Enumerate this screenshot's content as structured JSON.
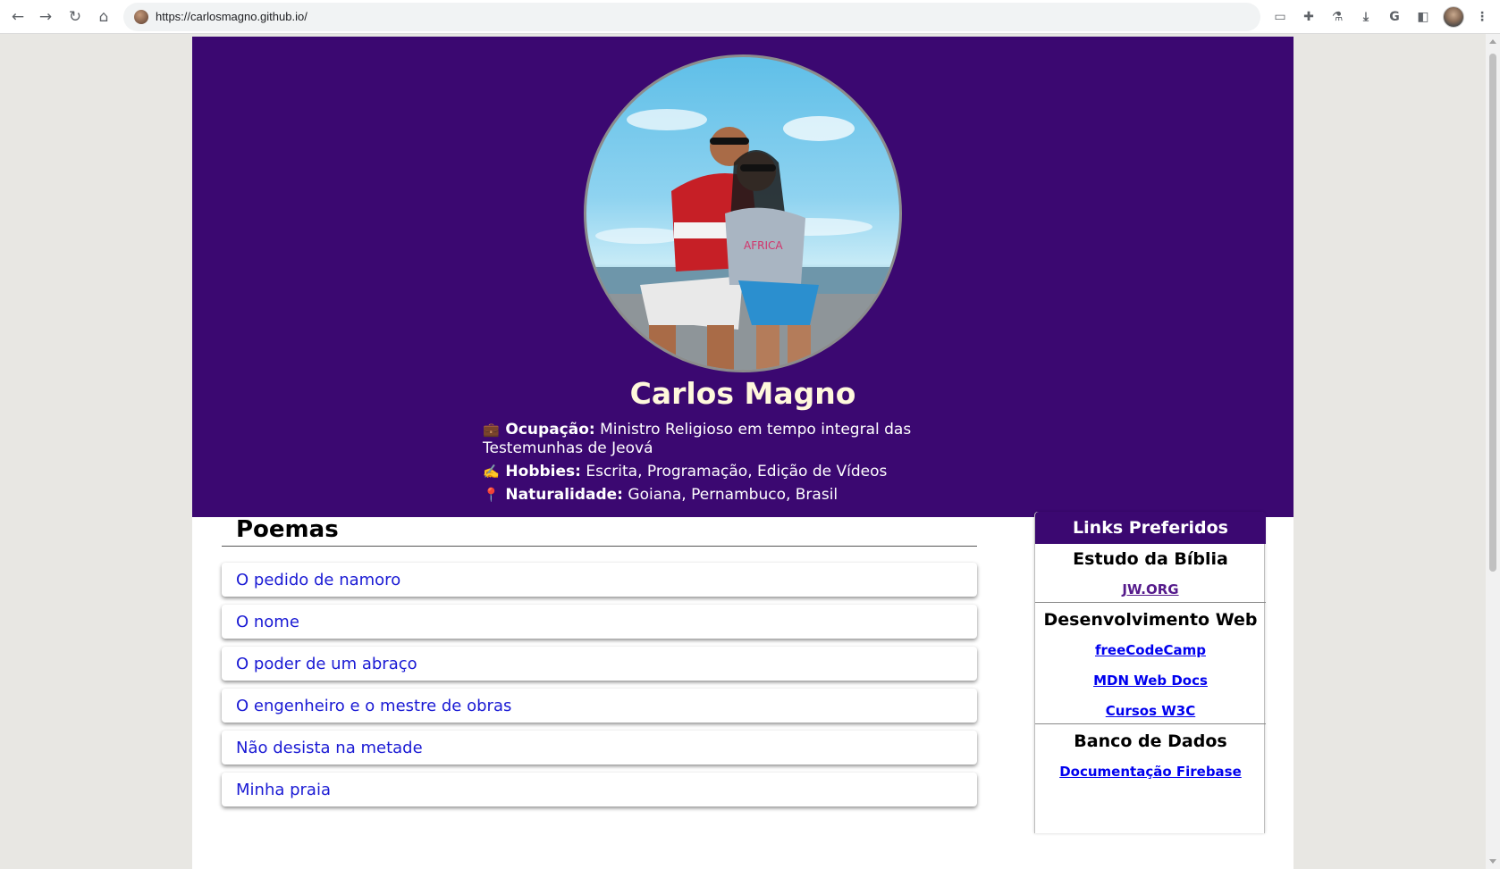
{
  "browser": {
    "url": "https://carlosmagno.github.io/",
    "nav_icons": {
      "back": "←",
      "forward": "→",
      "reload": "↻",
      "home": "⌂"
    },
    "toolbar_icons": [
      "cast-icon",
      "extensions-icon",
      "labs-icon",
      "download-icon",
      "google-icon",
      "side-panel-icon"
    ],
    "toolbar_glyphs": {
      "cast": "▭",
      "extensions": "✚",
      "labs": "⚗",
      "download": "⤓",
      "google": "G",
      "side_panel": "◧",
      "menu": "⋮"
    }
  },
  "profile": {
    "name": "Carlos Magno",
    "occupation_emoji": "💼",
    "occupation_label": "Ocupação:",
    "occupation_value": "Ministro Religioso em tempo integral das Testemunhas de Jeová",
    "hobbies_emoji": "✍️",
    "hobbies_label": "Hobbies:",
    "hobbies_value": "Escrita, Programação, Edição de Vídeos",
    "hometown_emoji": "📍",
    "hometown_label": "Naturalidade:",
    "hometown_value": "Goiana, Pernambuco, Brasil"
  },
  "poems": {
    "title": "Poemas",
    "items": [
      "O pedido de namoro",
      "O nome",
      "O poder de um abraço",
      "O engenheiro e o mestre de obras",
      "Não desista na metade",
      "Minha praia"
    ]
  },
  "links": {
    "title": "Links Preferidos",
    "sections": [
      {
        "title": "Estudo da Bíblia",
        "links": [
          "JW.ORG"
        ]
      },
      {
        "title": "Desenvolvimento Web",
        "links": [
          "freeCodeCamp",
          "MDN Web Docs",
          "Cursos W3C"
        ]
      },
      {
        "title": "Banco de Dados",
        "links": [
          "Documentação Firebase"
        ]
      }
    ]
  },
  "colors": {
    "header_bg": "#3b0871",
    "name_color": "#fff8dc",
    "poem_link": "#1a1ad4",
    "visited_link": "#551a8b",
    "unvisited_link": "#0000ee"
  }
}
